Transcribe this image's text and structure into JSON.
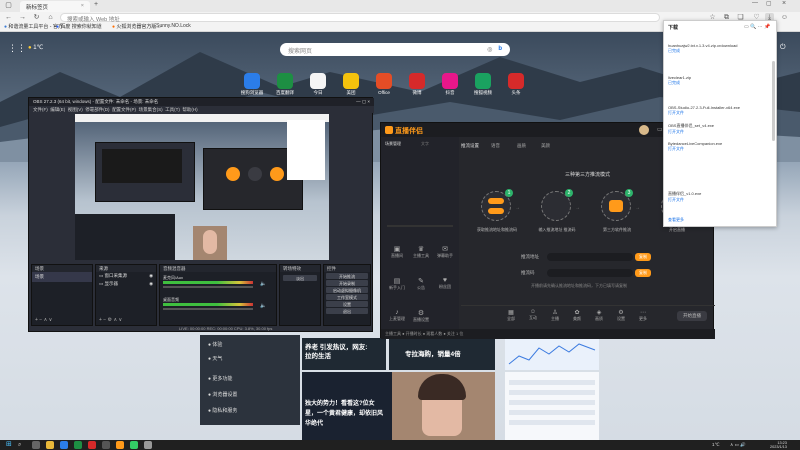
{
  "browser": {
    "tabs": [
      {
        "label": "新标签页"
      },
      {
        "label": "+"
      }
    ],
    "address_placeholder": "搜索或输入 Web 地址",
    "bookmarks": [
      {
        "label": "和谐流量工具平台 - 官方..."
      },
      {
        "label": "百度 搜索你就知道"
      },
      {
        "label": "火狐浏览器官方版..."
      },
      {
        "label": "Sunny.NO.Lock"
      }
    ]
  },
  "newtab": {
    "weather": "1℃",
    "search_placeholder": "搜索网页",
    "tiles": [
      {
        "label": "搜狗浏览器",
        "color": "#2b7de9"
      },
      {
        "label": "百度翻译",
        "color": "#1d8f43"
      },
      {
        "label": "今日",
        "color": "#f5f5f5"
      },
      {
        "label": "美团",
        "color": "#f4c20d"
      },
      {
        "label": "Office",
        "color": "#e44d26"
      },
      {
        "label": "微博",
        "color": "#d62a2a"
      },
      {
        "label": "抖音",
        "color": "#e8178a"
      },
      {
        "label": "搜狐视频",
        "color": "#1aa260"
      },
      {
        "label": "头条",
        "color": "#d62a2a"
      }
    ],
    "cards": {
      "headline1": "养老 引发热议，网友:",
      "headline1b": "拉的生活",
      "headline2": "专拉海购，销量4倍",
      "headline3": "独大的势力！看看这?位女",
      "headline3b": "星，一个黄君健康，却依旧风",
      "headline3c": "华绝代",
      "sidebar_items": [
        "体验",
        "天气",
        "更多功能",
        "浏览器设置",
        "隐私和服务"
      ]
    }
  },
  "obs": {
    "title": "OBS 27.2.3 (64 bit, windows) - 配置文件: 未命名 - 场景: 未命名",
    "menu": [
      "文件(F)",
      "编辑(E)",
      "视图(V)",
      "停靠部件(D)",
      "配置文件(P)",
      "场景集合(S)",
      "工具(T)",
      "帮助(H)"
    ],
    "docks": {
      "scenes": {
        "header": "场景",
        "items": [
          "场景"
        ]
      },
      "sources": {
        "header": "来源",
        "items": [
          "窗口采集源",
          "显示器"
        ]
      },
      "mixer": {
        "header": "音频混音器",
        "tracks": [
          "麦克风/Aux",
          "桌面音频"
        ]
      },
      "transitions": {
        "header": "转场特效",
        "mode": "淡出"
      },
      "controls": {
        "header": "控件",
        "buttons": [
          "开始推流",
          "开始录制",
          "启动虚拟摄像机",
          "工作室模式",
          "设置",
          "退出"
        ]
      }
    },
    "status": "LIVE: 00:00:00  REC: 00:00:00  CPU: 3.8%, 30.00 fps"
  },
  "streamer": {
    "brand": "直播伴侣",
    "left_tabs": [
      "场景管理",
      "文字"
    ],
    "tab_bar": [
      "推流设置",
      "语音",
      "画质",
      "美颜"
    ],
    "steps_title": "三种第三方推流模式",
    "steps": [
      {
        "label": "获取推流地址和推流码",
        "badge": "1"
      },
      {
        "label": "输入推流地址 推流码",
        "badge": "2"
      },
      {
        "label": "第三方软件推流",
        "badge": "3"
      },
      {
        "label": "开启直播",
        "badge": "4"
      }
    ],
    "help_btn": "帮助",
    "stream_url_label": "推流地址",
    "stream_key_label": "推流码",
    "copy_btn": "复制",
    "hint": "开播前请先确认推流地址和推流码，下方已填写请复制",
    "tools": [
      "全部",
      "互动",
      "主播",
      "美颜",
      "画质",
      "设置",
      "更多"
    ],
    "sidebar_tools": [
      "直播间",
      "主播工具",
      "弹幕助手",
      "新手入门",
      "公告",
      "粉丝团",
      "上麦管理",
      "直播设置"
    ],
    "bottom_status": "主播工具 ● 开播时长 ● 观看人数 ● 关注 1 位",
    "start_btn": "开始直播"
  },
  "downloads": {
    "title": "下载",
    "items": [
      {
        "name": "huanhuajw2.txt.v.1.3.v4.zip.crdownload",
        "status": "已完成"
      },
      {
        "name": "liveclear1.zip",
        "status": "已完成"
      },
      {
        "name": "OBS-Studio-27.2.3-Full-Installer-x64.exe",
        "status": "打开文件"
      },
      {
        "name": "OBS直播伴侣_set_v4.exe",
        "status": "打开文件"
      },
      {
        "name": "BytedanceLiveCompanion.exe",
        "status": "打开文件"
      },
      {
        "name": "直播伴侣_v1.0.exe",
        "status": "打开文件"
      }
    ],
    "more": "查看更多"
  },
  "taskbar": {
    "clock_time": "13:23",
    "clock_date": "2023/1/13",
    "temp": "1℃"
  }
}
